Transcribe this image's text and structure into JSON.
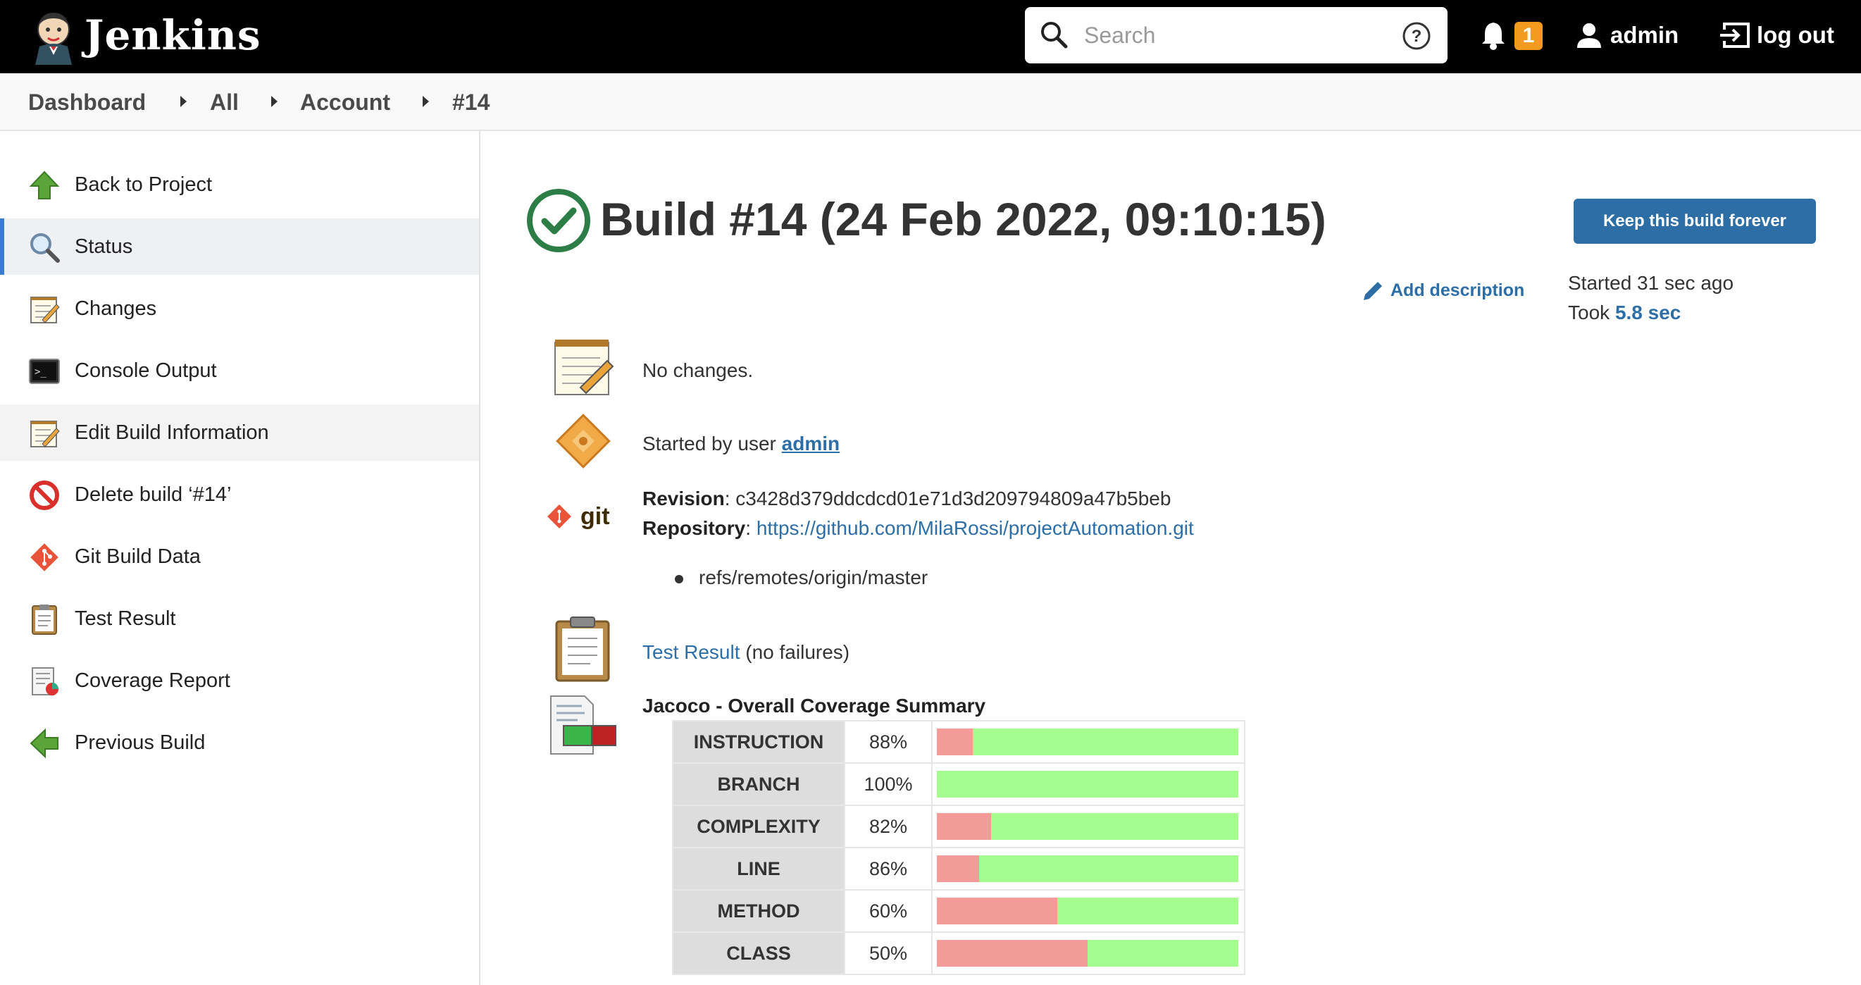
{
  "header": {
    "brand": "Jenkins",
    "search_placeholder": "Search",
    "notification_count": "1",
    "user": "admin",
    "logout": "log out"
  },
  "breadcrumb": [
    "Dashboard",
    "All",
    "Account",
    "#14"
  ],
  "sidebar": {
    "items": [
      {
        "label": "Back to Project",
        "icon": "up-arrow-icon"
      },
      {
        "label": "Status",
        "icon": "magnifier-icon"
      },
      {
        "label": "Changes",
        "icon": "notepad-icon"
      },
      {
        "label": "Console Output",
        "icon": "terminal-icon"
      },
      {
        "label": "Edit Build Information",
        "icon": "notepad-icon"
      },
      {
        "label": "Delete build ‘#14’",
        "icon": "no-entry-icon"
      },
      {
        "label": "Git Build Data",
        "icon": "git-icon"
      },
      {
        "label": "Test Result",
        "icon": "clipboard-icon"
      },
      {
        "label": "Coverage Report",
        "icon": "coverage-icon"
      },
      {
        "label": "Previous Build",
        "icon": "left-arrow-icon"
      }
    ]
  },
  "build": {
    "title": "Build #14 (24 Feb 2022, 09:10:15)",
    "keep_button": "Keep this build forever",
    "add_description": "Add description",
    "started": "Started 31 sec ago",
    "took_prefix": "Took ",
    "took_value": "5.8 sec",
    "changes": "No changes.",
    "started_by_prefix": "Started by user ",
    "started_by_user": "admin",
    "git_logo_text": "git",
    "revision_label": "Revision",
    "revision_value": "c3428d379ddcdcd01e71d3d209794809a47b5beb",
    "repository_label": "Repository",
    "repository_value": "https://github.com/MilaRossi/projectAutomation.git",
    "branch": "refs/remotes/origin/master",
    "test_result_link": "Test Result",
    "test_result_note": " (no failures)"
  },
  "coverage": {
    "title": "Jacoco - Overall Coverage Summary",
    "rows": [
      {
        "name": "INSTRUCTION",
        "percent": "88%",
        "covered": 0.88
      },
      {
        "name": "BRANCH",
        "percent": "100%",
        "covered": 1.0
      },
      {
        "name": "COMPLEXITY",
        "percent": "82%",
        "covered": 0.82
      },
      {
        "name": "LINE",
        "percent": "86%",
        "covered": 0.86
      },
      {
        "name": "METHOD",
        "percent": "60%",
        "covered": 0.6
      },
      {
        "name": "CLASS",
        "percent": "50%",
        "covered": 0.5
      }
    ],
    "colors": {
      "covered": "#a4fb8e",
      "missed": "#f29b99"
    }
  }
}
